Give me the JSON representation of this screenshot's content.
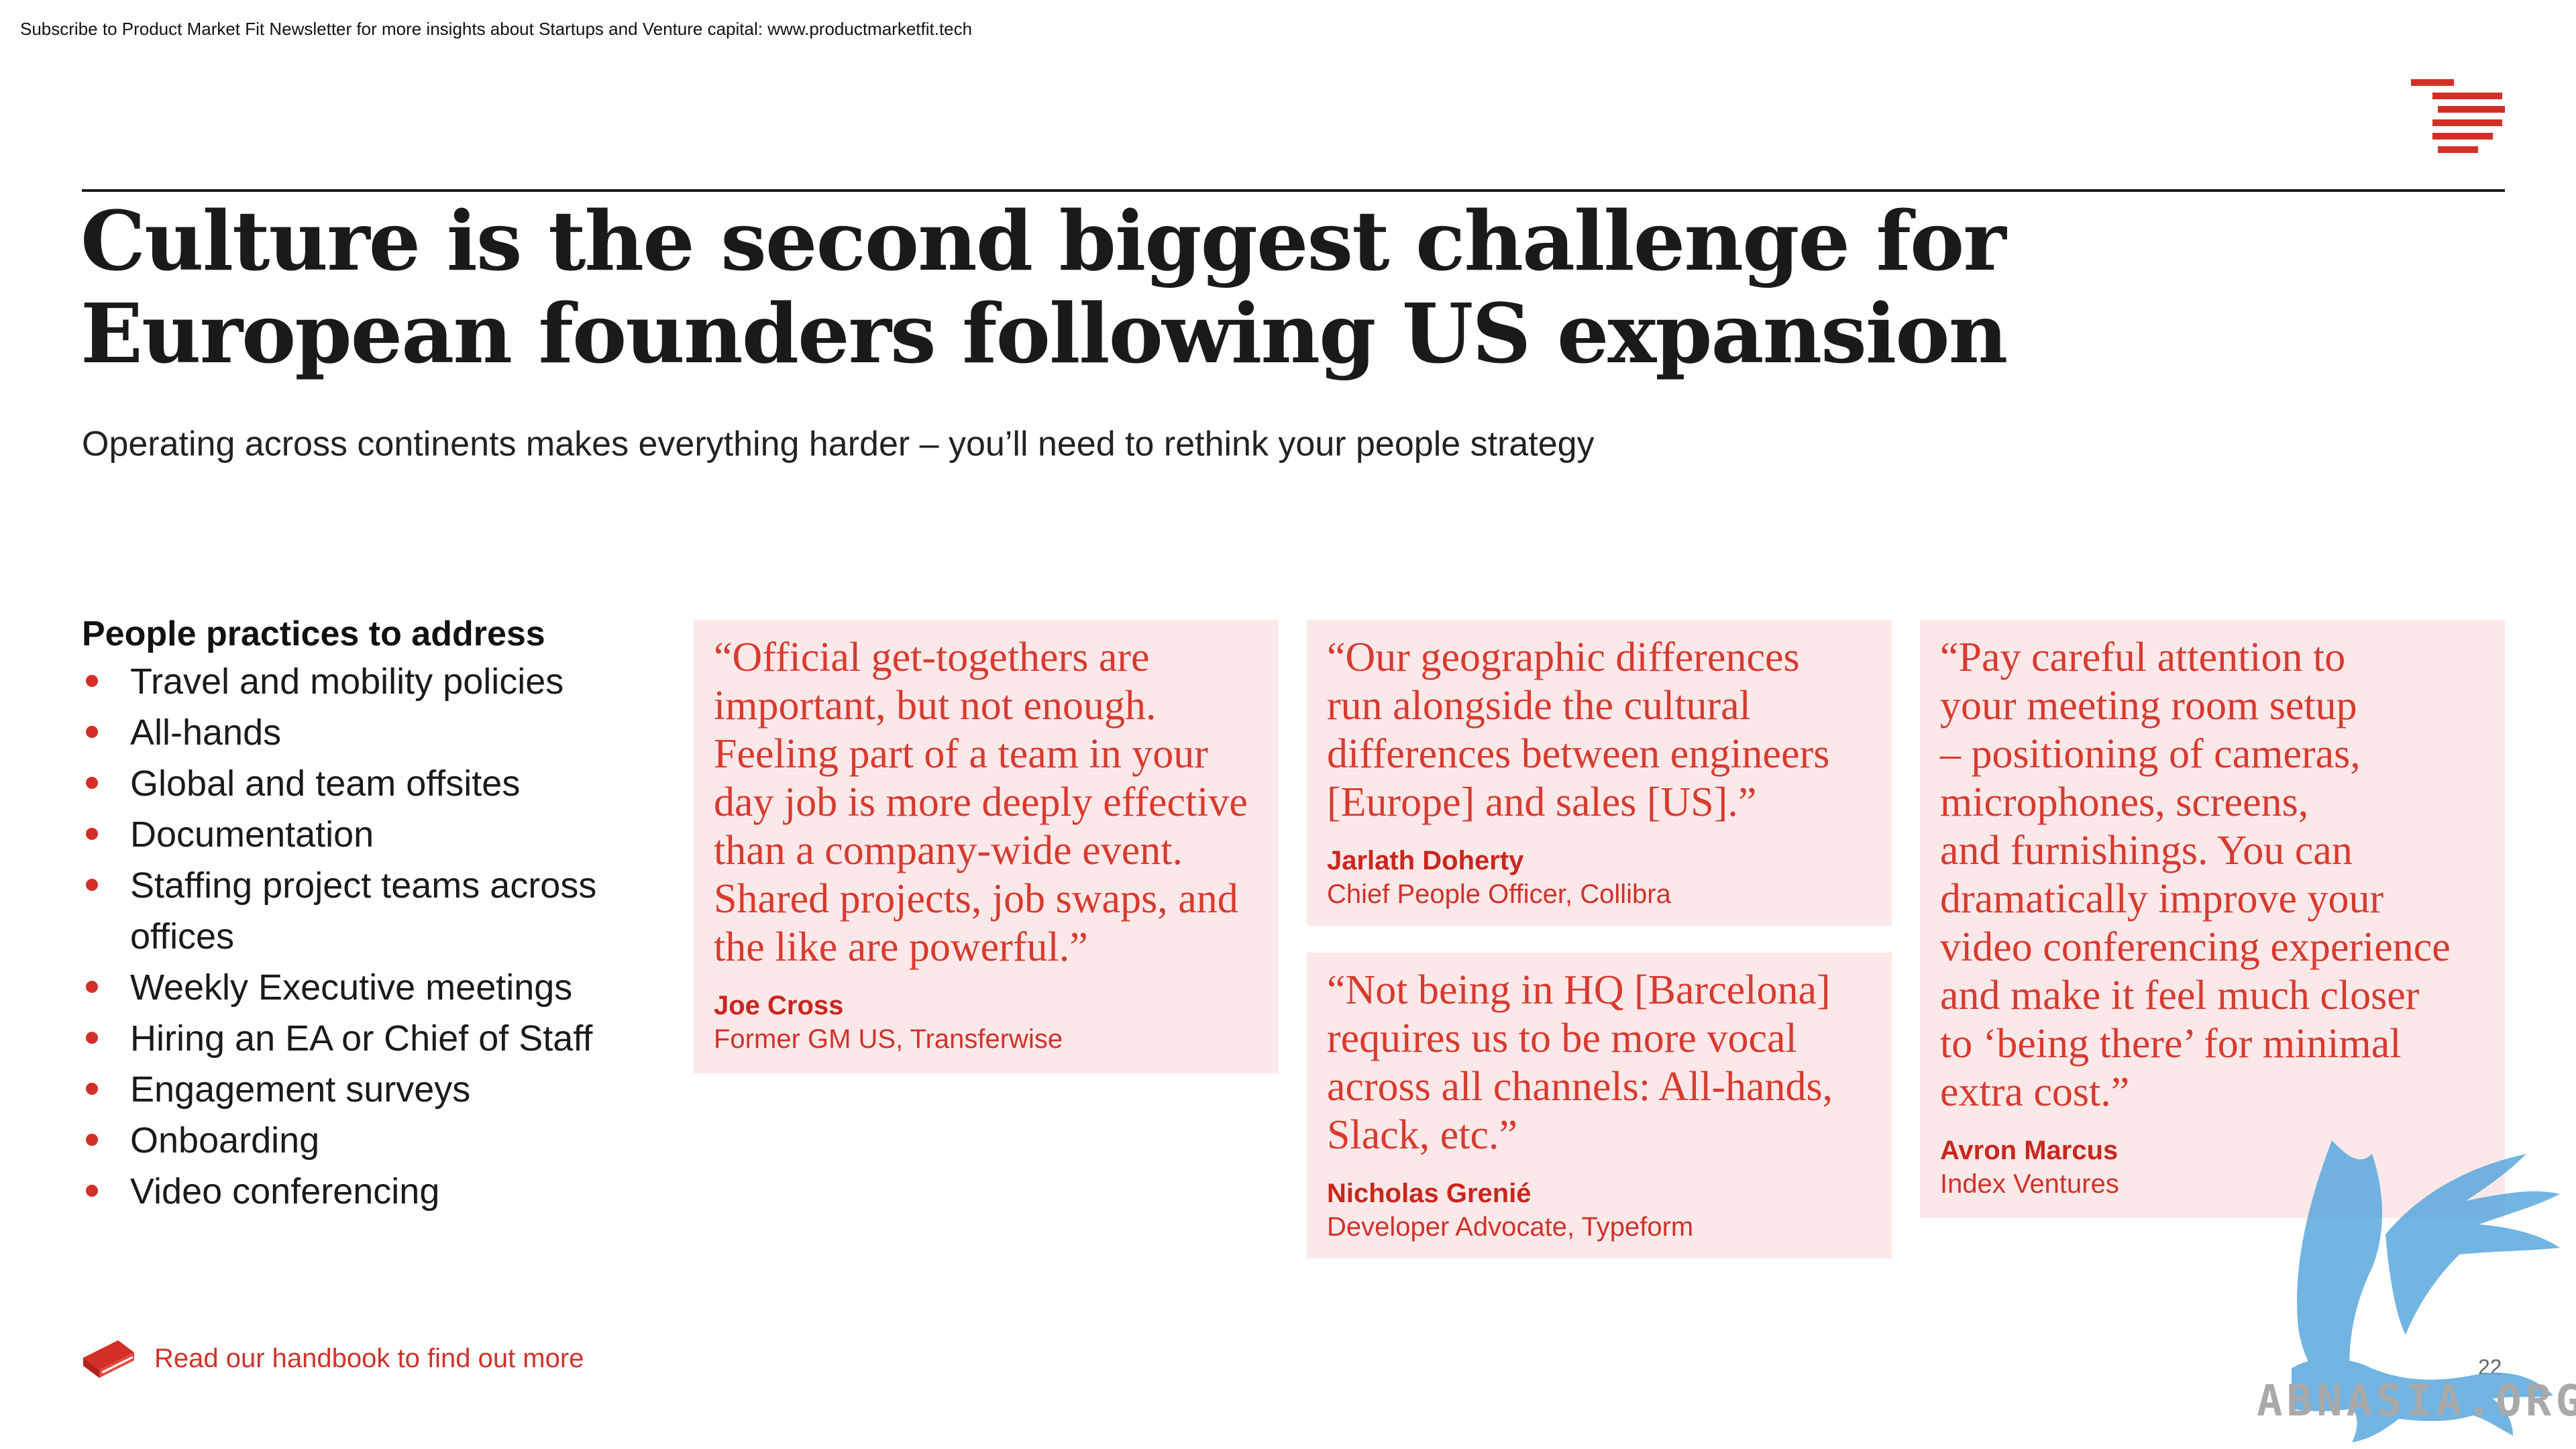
{
  "banner": "Subscribe to Product Market Fit Newsletter for more insights about Startups and Venture capital:  www.productmarketfit.tech",
  "title": {
    "line1": "Culture is the second biggest challenge for",
    "line2": "European founders following US expansion"
  },
  "subtitle": "Operating across continents makes everything harder – you’ll need to rethink your people strategy",
  "practices": {
    "heading": "People practices to address",
    "items": [
      "Travel and mobility policies",
      "All-hands",
      "Global and team offsites",
      "Documentation",
      "Staffing project teams across offices",
      "Weekly Executive meetings",
      "Hiring an EA or Chief of Staff",
      "Engagement surveys",
      "Onboarding",
      "Video conferencing"
    ]
  },
  "quotes": [
    {
      "text": "“Official get-togethers are\nimportant, but not enough.\nFeeling part of a team in your\nday job is more deeply effective\nthan a company-wide event.\nShared projects, job swaps, and\nthe like are powerful.”",
      "author": "Joe Cross",
      "role": "Former GM US, Transferwise"
    },
    {
      "text": "“Our geographic differences\nrun alongside the cultural\ndifferences between engineers\n[Europe] and sales [US].”",
      "author": "Jarlath Doherty",
      "role": "Chief People Officer, Collibra"
    },
    {
      "text": "“Not being in HQ [Barcelona]\nrequires us to be more vocal\nacross all channels: All-hands,\nSlack, etc.”",
      "author": "Nicholas Grenié",
      "role": "Developer Advocate, Typeform"
    },
    {
      "text": "“Pay careful attention to\nyour meeting room setup\n– positioning of cameras,\nmicrophones, screens,\nand furnishings. You can\ndramatically improve your\nvideo conferencing experience\nand make it feel much closer\nto ‘being there’ for minimal\nextra cost.”",
      "author": "Avron Marcus",
      "role": "Index Ventures"
    }
  ],
  "handbook": {
    "label": "Read our handbook to find out more",
    "icon": "book-icon"
  },
  "page_number": "22",
  "watermark": {
    "text": "ABNASIA.ORG",
    "icon": "griffin-icon"
  },
  "colors": {
    "accent": "#d32f27",
    "card_bg": "#fce8e8",
    "watermark_blue": "#5aa7de"
  }
}
